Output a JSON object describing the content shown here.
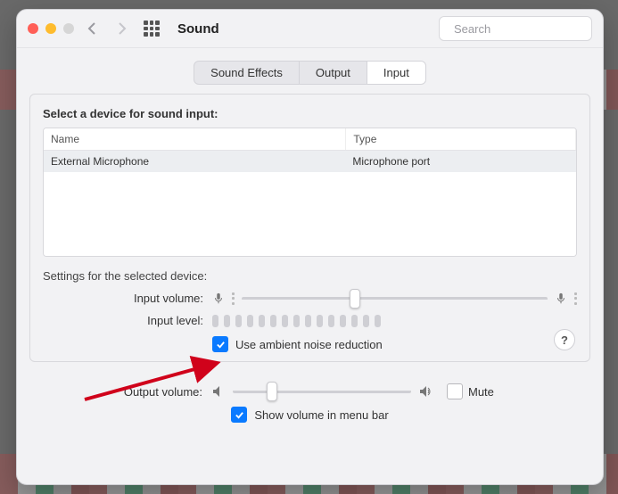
{
  "window": {
    "title": "Sound"
  },
  "search": {
    "placeholder": "Search"
  },
  "tabs": [
    "Sound Effects",
    "Output",
    "Input"
  ],
  "panel": {
    "selectLabel": "Select a device for sound input:",
    "columns": {
      "name": "Name",
      "type": "Type"
    },
    "row": {
      "name": "External Microphone",
      "type": "Microphone port"
    },
    "settingsLabel": "Settings for the selected device:",
    "inputVolume": "Input volume:",
    "inputLevel": "Input level:",
    "noiseReduction": "Use ambient noise reduction",
    "help": "?"
  },
  "bottom": {
    "outputVolume": "Output volume:",
    "mute": "Mute",
    "showVolume": "Show volume in menu bar"
  }
}
